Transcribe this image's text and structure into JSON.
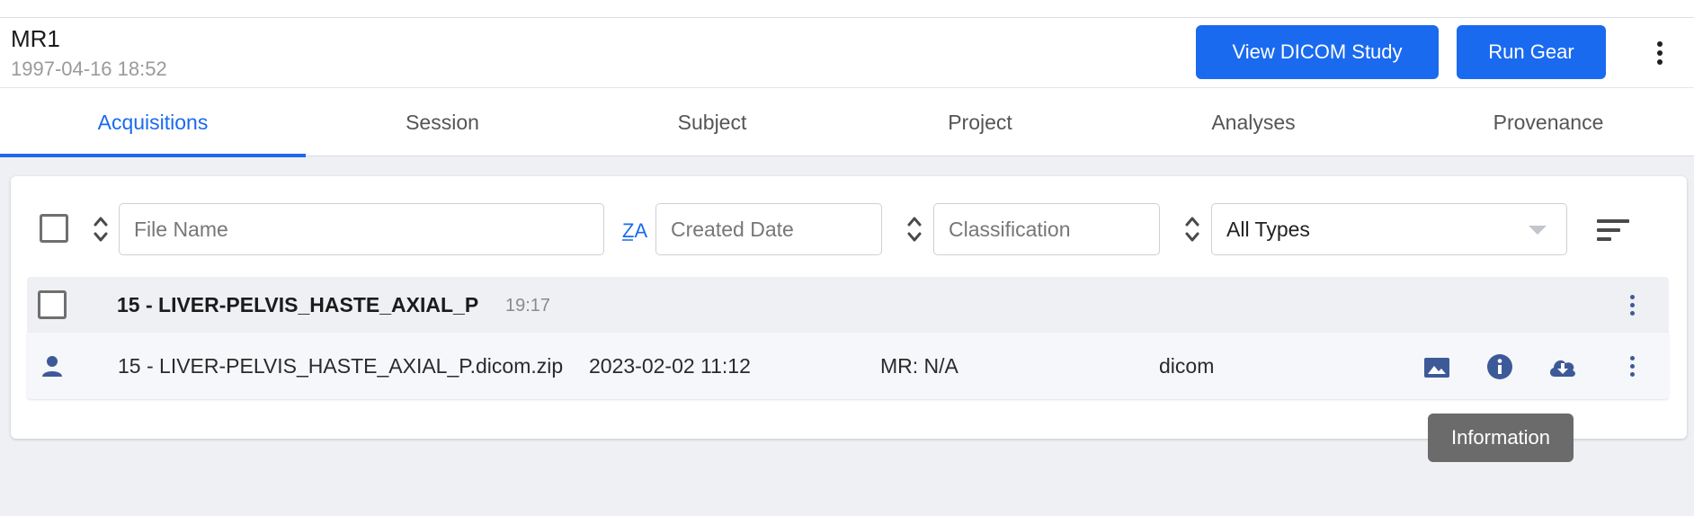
{
  "header": {
    "title": "MR1",
    "subtitle": "1997-04-16 18:52",
    "view_dicom_label": "View DICOM Study",
    "run_gear_label": "Run Gear"
  },
  "tabs": [
    {
      "label": "Acquisitions",
      "active": true
    },
    {
      "label": "Session"
    },
    {
      "label": "Subject"
    },
    {
      "label": "Project"
    },
    {
      "label": "Analyses"
    },
    {
      "label": "Provenance"
    }
  ],
  "filters": {
    "file_name_placeholder": "File Name",
    "created_date_placeholder": "Created Date",
    "classification_placeholder": "Classification",
    "type_selected": "All Types"
  },
  "group": {
    "name": "15 - LIVER-PELVIS_HASTE_AXIAL_P",
    "time": "19:17"
  },
  "file": {
    "name": "15 - LIVER-PELVIS_HASTE_AXIAL_P.dicom.zip",
    "created": "2023-02-02 11:12",
    "classification": "MR: N/A",
    "type": "dicom"
  },
  "tooltip": "Information",
  "colors": {
    "accent": "#1a6af0",
    "icon_blue": "#3d5a98"
  }
}
